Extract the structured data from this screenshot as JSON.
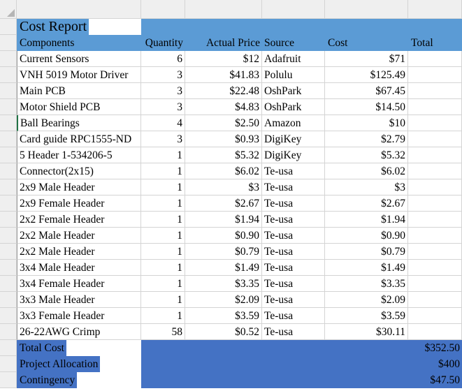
{
  "columns": [
    "A",
    "B",
    "C",
    "D",
    "E",
    "F"
  ],
  "header_bg": "#5b9bd5",
  "total_bg": "#4472c4",
  "rows": [
    {
      "n": "1",
      "cells": [
        "Cost Report",
        "",
        "",
        "",
        "",
        ""
      ],
      "style": "title"
    },
    {
      "n": "2",
      "cells": [
        "Components",
        "Quantity",
        "Actual Price",
        "Source",
        "Cost",
        "Total"
      ],
      "style": "header"
    },
    {
      "n": "3",
      "cells": [
        "Current Sensors",
        "6",
        "$12",
        "Adafruit",
        "$71",
        ""
      ]
    },
    {
      "n": "4",
      "cells": [
        "VNH 5019 Motor Driver",
        "3",
        "$41.83",
        "Polulu",
        "$125.49",
        ""
      ]
    },
    {
      "n": "5",
      "cells": [
        "Main PCB",
        "3",
        "$22.48",
        "OshPark",
        "$67.45",
        ""
      ]
    },
    {
      "n": "6",
      "cells": [
        "Motor Shield PCB",
        "3",
        "$4.83",
        "OshPark",
        "$14.50",
        ""
      ]
    },
    {
      "n": "7",
      "cells": [
        "Ball Bearings",
        "4",
        "$2.50",
        "Amazon",
        "$10",
        ""
      ]
    },
    {
      "n": "8",
      "cells": [
        "Card guide RPC1555-ND",
        "3",
        "$0.93",
        "DigiKey",
        "$2.79",
        ""
      ]
    },
    {
      "n": "9",
      "cells": [
        "5 Header 1-534206-5",
        "1",
        "$5.32",
        "DigiKey",
        "$5.32",
        ""
      ]
    },
    {
      "n": "10",
      "cells": [
        "Connector(2x15)",
        "1",
        "$6.02",
        "Te-usa",
        "$6.02",
        ""
      ]
    },
    {
      "n": "11",
      "cells": [
        "2x9 Male Header",
        "1",
        "$3",
        "Te-usa",
        "$3",
        ""
      ]
    },
    {
      "n": "12",
      "cells": [
        "2x9 Female Header",
        "1",
        "$2.67",
        "Te-usa",
        "$2.67",
        ""
      ]
    },
    {
      "n": "13",
      "cells": [
        "2x2 Female Header",
        "1",
        "$1.94",
        "Te-usa",
        "$1.94",
        ""
      ]
    },
    {
      "n": "14",
      "cells": [
        "2x2 Male Header",
        "1",
        "$0.90",
        "Te-usa",
        "$0.90",
        ""
      ]
    },
    {
      "n": "15",
      "cells": [
        "2x2 Male Header",
        "1",
        "$0.79",
        "Te-usa",
        "$0.79",
        ""
      ]
    },
    {
      "n": "16",
      "cells": [
        "3x4 Male Header",
        "1",
        "$1.49",
        "Te-usa",
        "$1.49",
        ""
      ]
    },
    {
      "n": "17",
      "cells": [
        "3x4 Female Header",
        "1",
        "$3.35",
        "Te-usa",
        "$3.35",
        ""
      ]
    },
    {
      "n": "18",
      "cells": [
        "3x3 Male Header",
        "1",
        "$2.09",
        "Te-usa",
        "$2.09",
        ""
      ]
    },
    {
      "n": "19",
      "cells": [
        "3x3 Female Header",
        "1",
        "$3.59",
        "Te-usa",
        "$3.59",
        ""
      ]
    },
    {
      "n": "20",
      "cells": [
        "26-22AWG Crimp",
        "58",
        "$0.52",
        "Te-usa",
        "$30.11",
        ""
      ]
    },
    {
      "n": "21",
      "cells": [
        "Total Cost",
        "",
        "",
        "",
        "",
        "$352.50"
      ],
      "style": "total"
    },
    {
      "n": "22",
      "cells": [
        "Project Allocation",
        "",
        "",
        "",
        "",
        "$400"
      ],
      "style": "total"
    },
    {
      "n": "23",
      "cells": [
        "Contingency",
        "",
        "",
        "",
        "",
        "$47.50"
      ],
      "style": "total"
    }
  ]
}
